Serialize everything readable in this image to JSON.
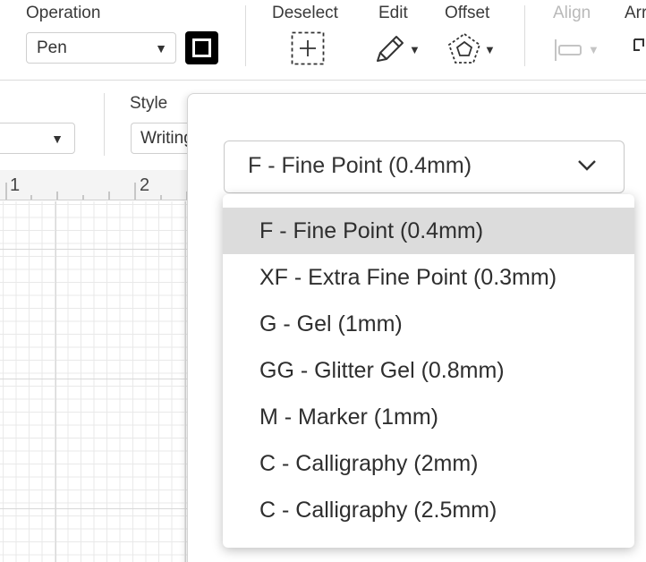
{
  "toolbar": {
    "operation_label": "Operation",
    "operation_value": "Pen",
    "pen_color": "#000000",
    "deselect_label": "Deselect",
    "edit_label": "Edit",
    "offset_label": "Offset",
    "align_label": "Align",
    "arrange_label": "Arr"
  },
  "secondary": {
    "style_label": "Style",
    "style_value": "Writing"
  },
  "ruler": {
    "marks": [
      "1",
      "2"
    ]
  },
  "pen_type": {
    "selected": "F - Fine Point (0.4mm)",
    "options": [
      "F - Fine Point (0.4mm)",
      "XF - Extra Fine Point (0.3mm)",
      "G - Gel (1mm)",
      "GG - Glitter Gel (0.8mm)",
      "M - Marker (1mm)",
      "C - Calligraphy (2mm)",
      "C - Calligraphy (2.5mm)"
    ]
  }
}
